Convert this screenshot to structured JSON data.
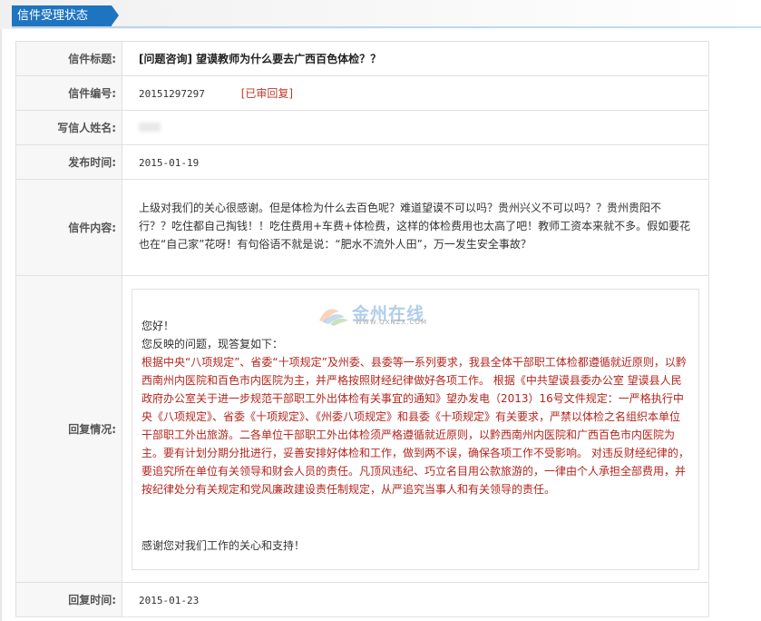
{
  "header": {
    "title": "信件受理状态"
  },
  "fields": {
    "title_label": "信件标题:",
    "title_value": "[问题咨询] 望谟教师为什么要去广西百色体检？？",
    "number_label": "信件编号:",
    "number_value": "20151297297",
    "status_value": "[已审回复]",
    "author_label": "写信人姓名:",
    "publish_label": "发布时间:",
    "publish_value": "2015-01-19",
    "content_label": "信件内容:",
    "content_value": "上级对我们的关心很感谢。但是体检为什么去百色呢？难道望谟不可以吗？贵州兴义不可以吗？？贵州贵阳不行？？吃住都自己掏钱！！吃住费用+车费+体检费，这样的体检费用也太高了吧！教师工资本来就不多。假如要花也在“自己家”花呀！有句俗语不就是说：“肥水不流外人田”，万一发生安全事故？",
    "reply_label": "回复情况:",
    "reply_greeting": "您好！",
    "reply_intro": "您反映的问题，现答复如下：",
    "reply_body": "根据中央“八项规定”、省委“十项规定”及州委、县委等一系列要求，我县全体干部职工体检都遵循就近原则，以黔西南州内医院和百色市内医院为主，并严格按照财经纪律做好各项工作。 根据《中共望谟县委办公室 望谟县人民政府办公室关于进一步规范干部职工外出体检有关事宜的通知》望办发电（2013）16号文件规定：一严格执行中央《八项规定》、省委《十项规定》、《州委八项规定》和县委《十项规定》有关要求，严禁以体检之名组织本单位干部职工外出旅游。二各单位干部职工外出体检须严格遵循就近原则，以黔西南州内医院和广西百色市内医院为主。要有计划分期分批进行，妥善安排好体检和工作，做到两不误，确保各项工作不受影响。 对违反财经纪律的，要追究所在单位有关领导和财会人员的责任。凡顶风违纪、巧立名目用公款旅游的，一律由个人承担全部费用，并按纪律处分有关规定和党风廉政建设责任制规定，从严追究当事人和有关领导的责任。",
    "reply_thanks": "感谢您对我们工作的关心和支持！",
    "reply_time_label": "回复时间:",
    "reply_time_value": "2015-01-23"
  },
  "watermark": {
    "text": "金州在线",
    "sub": "WWW.QXNZX.COM"
  }
}
